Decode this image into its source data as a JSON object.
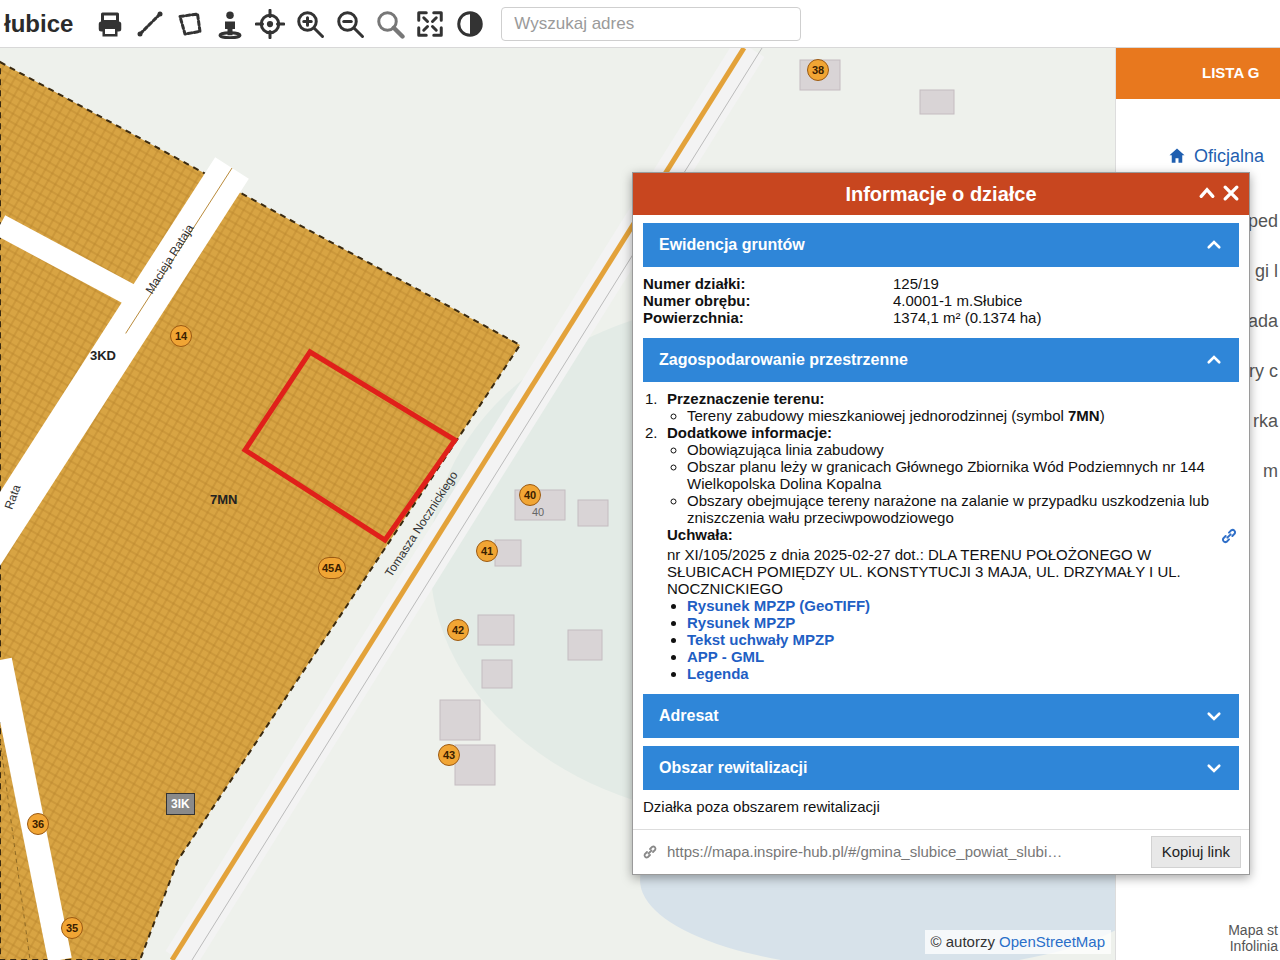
{
  "toolbar": {
    "title": "łubice",
    "search_placeholder": "Wyszukaj adres"
  },
  "map": {
    "zones": [
      {
        "label": "7MN"
      },
      {
        "label": "3KD"
      },
      {
        "label": "3IK"
      }
    ],
    "streets": [
      {
        "label": "Macieja Rataja"
      },
      {
        "label": "Tomasza Nocznickiego"
      },
      {
        "label": "Rata"
      }
    ],
    "pins": [
      {
        "label": "38"
      },
      {
        "label": "14"
      },
      {
        "label": "40"
      },
      {
        "label": "41"
      },
      {
        "label": "42"
      },
      {
        "label": "43"
      },
      {
        "label": "45A"
      },
      {
        "label": "36"
      },
      {
        "label": "35"
      }
    ],
    "house_numbers": [
      {
        "label": "40"
      }
    ],
    "attribution_prefix": "© autorzy ",
    "attribution_link": "OpenStreetMap"
  },
  "side_panel": {
    "header": "LISTA G",
    "link": "Oficjalna",
    "fragments": [
      "ped",
      "gi l",
      "ada",
      "ry c",
      "rka",
      "m"
    ],
    "footer": [
      "Mapa st",
      "Infolinia"
    ]
  },
  "popup": {
    "title": "Informacje o działce",
    "sections": [
      {
        "title": "Ewidencja gruntów",
        "expanded": true,
        "kind": "fields",
        "fields": [
          {
            "label": "Numer działki:",
            "value": "125/19"
          },
          {
            "label": "Numer obrębu:",
            "value": "4.0001-1 m.Słubice"
          },
          {
            "label": "Powierzchnia:",
            "value": "1374,1 m² (0.1374 ha)"
          }
        ]
      },
      {
        "title": "Zagospodarowanie przestrzenne",
        "expanded": true,
        "kind": "plan",
        "items": [
          {
            "number": "1.",
            "heading": "Przeznaczenie terenu:",
            "bullets": [
              {
                "text": "Tereny zabudowy mieszkaniowej jednorodzinnej (symbol ",
                "bold": "7MN",
                "after": ")"
              }
            ]
          },
          {
            "number": "2.",
            "heading": "Dodatkowe informacje:",
            "bullets": [
              {
                "text": "Obowiązująca linia zabudowy"
              },
              {
                "text": "Obszar planu leży w granicach Głównego Zbiornika Wód Podziemnych nr 144 Wielkopolska Dolina Kopalna"
              },
              {
                "text": "Obszary obejmujące tereny narażone na zalanie w przypadku uszkodzenia lub zniszczenia wału przeciwpowodziowego"
              }
            ]
          }
        ],
        "resolution_label": "Uchwała:",
        "resolution_text": "nr XI/105/2025 z dnia 2025-02-27 dot.: DLA TERENU POŁOŻONEGO W SŁUBICACH POMIĘDZY UL. KONSTYTUCJI 3 MAJA, UL. DRZYMAŁY I UL. NOCZNICKIEGO",
        "links": [
          "Rysunek MPZP (GeoTIFF)",
          "Rysunek MPZP",
          "Tekst uchwały MPZP",
          "APP - GML",
          "Legenda"
        ]
      },
      {
        "title": "Adresat",
        "expanded": false,
        "kind": "empty"
      },
      {
        "title": "Obszar rewitalizacji",
        "expanded": false,
        "kind": "note",
        "note": "Działka poza obszarem rewitalizacji"
      }
    ],
    "share_url": "https://mapa.inspire-hub.pl/#/gmina_slubice_powiat_slubi…",
    "copy_button": "Kopiuj link"
  }
}
